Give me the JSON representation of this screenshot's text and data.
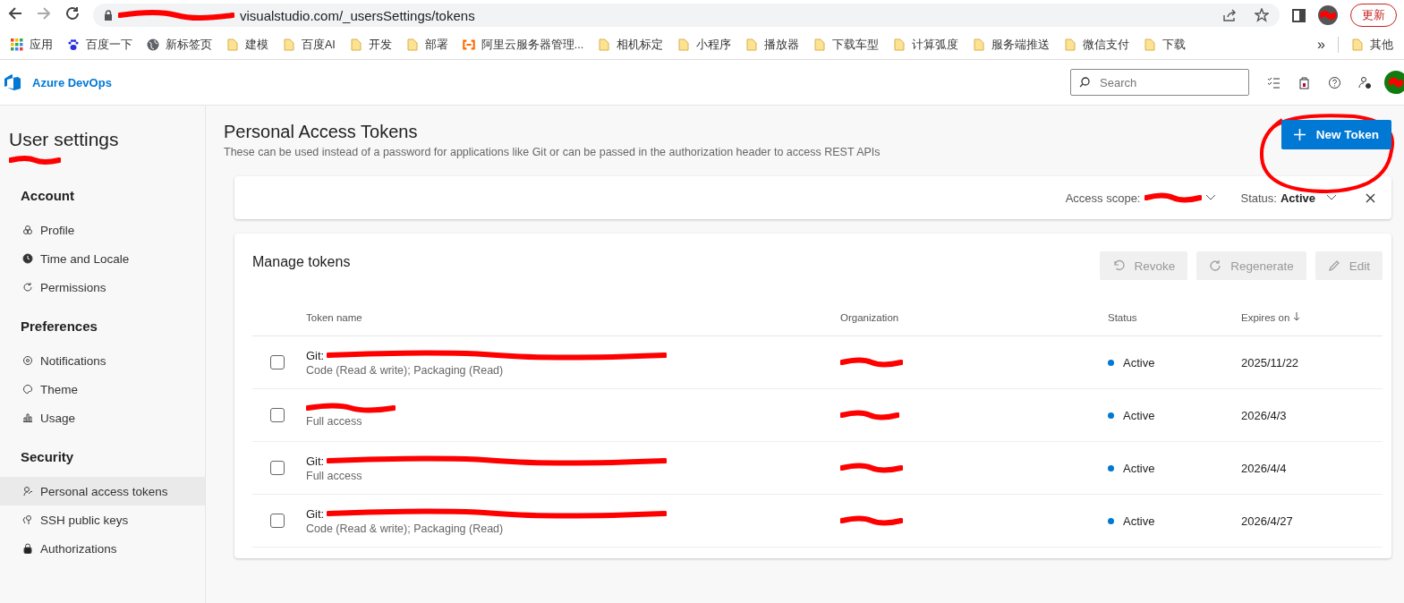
{
  "browser": {
    "url": "visualstudio.com/_usersSettings/tokens",
    "update_button": "更新",
    "bookmarks": [
      {
        "kind": "apps",
        "label": "应用"
      },
      {
        "kind": "paw",
        "label": "百度一下"
      },
      {
        "kind": "globe",
        "label": "新标签页"
      },
      {
        "kind": "folder",
        "label": "建模"
      },
      {
        "kind": "folder",
        "label": "百度AI"
      },
      {
        "kind": "folder",
        "label": "开发"
      },
      {
        "kind": "folder",
        "label": "部署"
      },
      {
        "kind": "cloud",
        "label": "阿里云服务器管理..."
      },
      {
        "kind": "folder",
        "label": "相机标定"
      },
      {
        "kind": "folder",
        "label": "小程序"
      },
      {
        "kind": "folder",
        "label": "播放器"
      },
      {
        "kind": "folder",
        "label": "下载车型"
      },
      {
        "kind": "folder",
        "label": "计算弧度"
      },
      {
        "kind": "folder",
        "label": "服务端推送"
      },
      {
        "kind": "folder",
        "label": "微信支付"
      },
      {
        "kind": "folder",
        "label": "下载"
      }
    ],
    "more": "»",
    "other_bookmarks": "其他"
  },
  "app": {
    "name": "Azure DevOps",
    "search": {
      "placeholder": "Search"
    }
  },
  "sidebar": {
    "title": "User settings",
    "sections": [
      {
        "heading": "Account",
        "items": [
          {
            "label": "Profile",
            "selected": false
          },
          {
            "label": "Time and Locale",
            "selected": false
          },
          {
            "label": "Permissions",
            "selected": false
          }
        ]
      },
      {
        "heading": "Preferences",
        "items": [
          {
            "label": "Notifications",
            "selected": false
          },
          {
            "label": "Theme",
            "selected": false
          },
          {
            "label": "Usage",
            "selected": false
          }
        ]
      },
      {
        "heading": "Security",
        "items": [
          {
            "label": "Personal access tokens",
            "selected": true
          },
          {
            "label": "SSH public keys",
            "selected": false
          },
          {
            "label": "Authorizations",
            "selected": false
          }
        ]
      }
    ]
  },
  "page": {
    "title": "Personal Access Tokens",
    "subtitle": "These can be used instead of a password for applications like Git or can be passed in the authorization header to access REST APIs",
    "new_button": "New Token"
  },
  "filter": {
    "scope_label": "Access scope:",
    "status_label": "Status:",
    "status_value": "Active"
  },
  "tokens": {
    "title": "Manage tokens",
    "actions": [
      {
        "label": "Revoke"
      },
      {
        "label": "Regenerate"
      },
      {
        "label": "Edit"
      }
    ],
    "columns": [
      "Token name",
      "Organization",
      "Status",
      "Expires on"
    ],
    "rows": [
      {
        "name": "Git:",
        "scope": "Code (Read & write); Packaging (Read)",
        "status": "Active",
        "expires": "2025/11/22",
        "checked": false
      },
      {
        "scope": "Full access",
        "status": "Active",
        "expires": "2026/4/3",
        "checked": false
      },
      {
        "name": "Git:",
        "scope": "Full access",
        "status": "Active",
        "expires": "2026/4/4",
        "checked": false
      },
      {
        "name": "Git:",
        "scope": "Code (Read & write); Packaging (Read)",
        "status": "Active",
        "expires": "2026/4/27",
        "checked": false
      }
    ]
  }
}
